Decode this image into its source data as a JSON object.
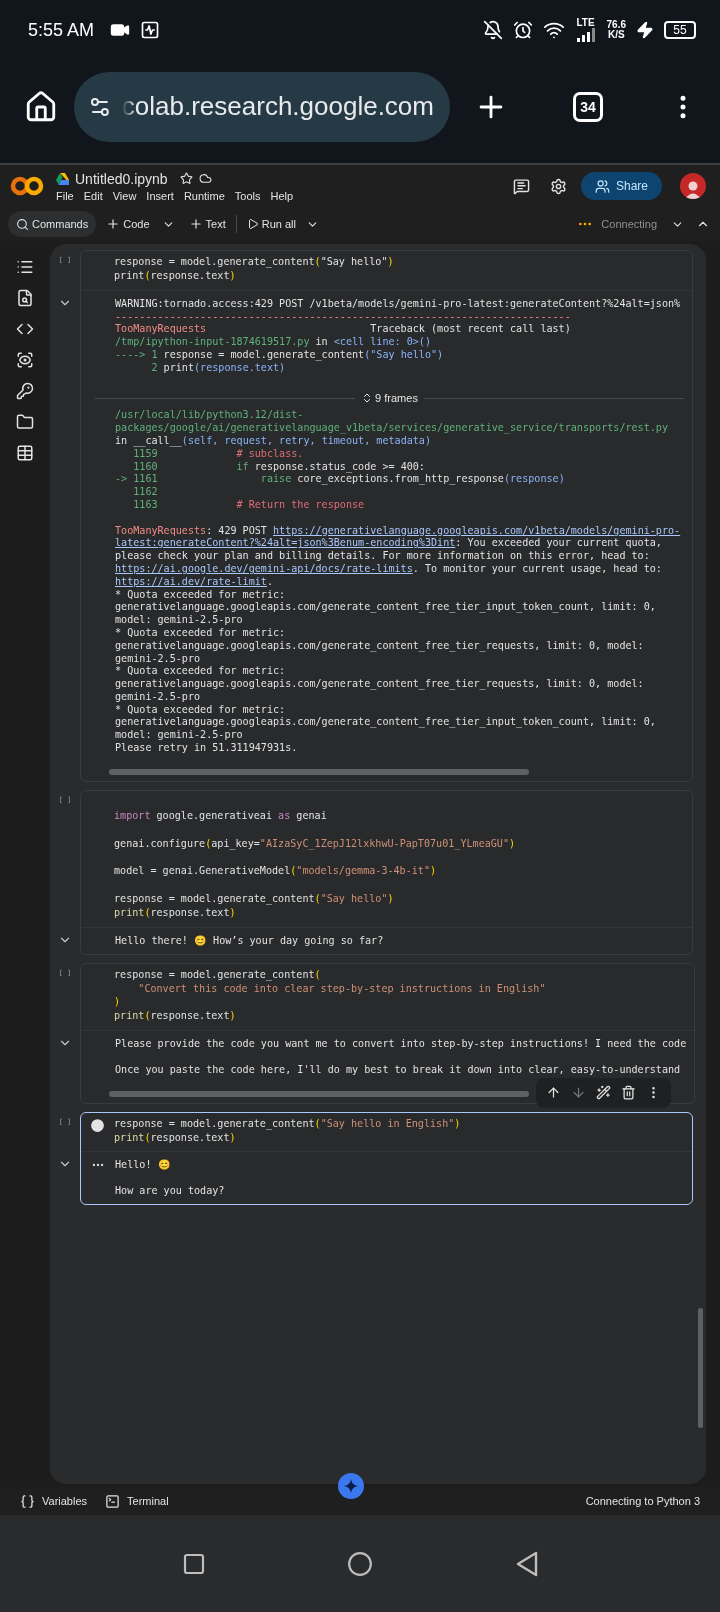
{
  "status_bar": {
    "time": "5:55 AM",
    "network": "LTE",
    "speed_value": "76.6",
    "speed_unit": "K/S",
    "battery": "55"
  },
  "browser": {
    "url": "colab.research.google.com",
    "tab_count": "34"
  },
  "notebook": {
    "title": "Untitled0.ipynb",
    "menu": [
      "File",
      "Edit",
      "View",
      "Insert",
      "Runtime",
      "Tools",
      "Help"
    ],
    "share_label": "Share"
  },
  "toolbar": {
    "commands": "Commands",
    "code": "Code",
    "text": "Text",
    "run_all": "Run all",
    "status": "Connecting"
  },
  "cells": [
    {
      "execution_count": "[ ]",
      "selected": false,
      "h_scrollbar": true,
      "code": [
        {
          "tokens": [
            {
              "kind": "plain",
              "text": "response = model.generate_content"
            },
            {
              "kind": "paren",
              "text": "("
            },
            {
              "kind": "plain",
              "text": "\"Say hello\""
            },
            {
              "kind": "paren",
              "text": ")"
            }
          ]
        },
        {
          "tokens": [
            {
              "kind": "plain",
              "text": "print"
            },
            {
              "kind": "paren",
              "text": "("
            },
            {
              "kind": "plain",
              "text": "response.text"
            },
            {
              "kind": "paren",
              "text": ")"
            }
          ]
        }
      ],
      "output": [
        {
          "tokens": [
            {
              "kind": "plain",
              "text": "WARNING:tornado.access:429 POST /v1beta/models/gemini-pro-latest:generateContent?%24alt=json%"
            }
          ]
        },
        {
          "tokens": [
            {
              "kind": "err",
              "text": "---------------------------------------------------------------------------"
            }
          ]
        },
        {
          "tokens": [
            {
              "kind": "err",
              "text": "TooManyRequests"
            },
            {
              "kind": "plain",
              "text": "                           Traceback (most recent call last)"
            }
          ]
        },
        {
          "tokens": [
            {
              "kind": "green",
              "text": "/tmp/ipython-input-1874619517.py"
            },
            {
              "kind": "plain",
              "text": " in "
            },
            {
              "kind": "blue",
              "text": "<cell line: 0>()"
            }
          ]
        },
        {
          "tokens": [
            {
              "kind": "green",
              "text": "----> 1"
            },
            {
              "kind": "plain",
              "text": " response = model.generate_content"
            },
            {
              "kind": "blue",
              "text": "(\"Say hello\")"
            }
          ]
        },
        {
          "tokens": [
            {
              "kind": "green",
              "text": "      2"
            },
            {
              "kind": "plain",
              "text": " print"
            },
            {
              "kind": "blue",
              "text": "(response.text)"
            }
          ]
        },
        {
          "kind": "blank"
        },
        {
          "kind": "frames",
          "label": "9 frames"
        },
        {
          "tokens": [
            {
              "kind": "green",
              "text": "/usr/local/lib/python3.12/dist-"
            }
          ]
        },
        {
          "tokens": [
            {
              "kind": "green",
              "text": "packages/google/ai/generativelanguage_v1beta/services/generative_service/transports/rest.py"
            }
          ]
        },
        {
          "tokens": [
            {
              "kind": "plain",
              "text": "in __call__"
            },
            {
              "kind": "blue",
              "text": "(self, request, retry, timeout, metadata)"
            }
          ]
        },
        {
          "tokens": [
            {
              "kind": "green",
              "text": "   1159"
            },
            {
              "kind": "comment",
              "text": "             # subclass."
            }
          ]
        },
        {
          "tokens": [
            {
              "kind": "green",
              "text": "   1160             if"
            },
            {
              "kind": "plain",
              "text": " response.status_code >= 400:"
            }
          ]
        },
        {
          "tokens": [
            {
              "kind": "green",
              "text": "-> 1161                 raise"
            },
            {
              "kind": "plain",
              "text": " core_exceptions.from_http_response"
            },
            {
              "kind": "blue",
              "text": "(response)"
            }
          ]
        },
        {
          "tokens": [
            {
              "kind": "green",
              "text": "   1162"
            }
          ]
        },
        {
          "tokens": [
            {
              "kind": "green",
              "text": "   1163"
            },
            {
              "kind": "comment",
              "text": "             # Return the response"
            }
          ]
        },
        {
          "kind": "blank"
        },
        {
          "tokens": [
            {
              "kind": "err",
              "text": "TooManyRequests"
            },
            {
              "kind": "plain",
              "text": ": 429 POST "
            },
            {
              "kind": "link",
              "text": "https://generativelanguage.googleapis.com/v1beta/models/gemini-pro-"
            }
          ]
        },
        {
          "tokens": [
            {
              "kind": "link",
              "text": "latest:generateContent?%24alt=json%3Benum-encoding%3Dint"
            },
            {
              "kind": "plain",
              "text": ": You exceeded your current quota,"
            }
          ]
        },
        {
          "tokens": [
            {
              "kind": "plain",
              "text": "please check your plan and billing details. For more information on this error, head to:"
            }
          ]
        },
        {
          "tokens": [
            {
              "kind": "link",
              "text": "https://ai.google.dev/gemini-api/docs/rate-limits"
            },
            {
              "kind": "plain",
              "text": ". To monitor your current usage, head to:"
            }
          ]
        },
        {
          "tokens": [
            {
              "kind": "link",
              "text": "https://ai.dev/rate-limit"
            },
            {
              "kind": "plain",
              "text": "."
            }
          ]
        },
        {
          "tokens": [
            {
              "kind": "plain",
              "text": "* Quota exceeded for metric:"
            }
          ]
        },
        {
          "tokens": [
            {
              "kind": "plain",
              "text": "generativelanguage.googleapis.com/generate_content_free_tier_input_token_count, limit: 0,"
            }
          ]
        },
        {
          "tokens": [
            {
              "kind": "plain",
              "text": "model: gemini-2.5-pro"
            }
          ]
        },
        {
          "tokens": [
            {
              "kind": "plain",
              "text": "* Quota exceeded for metric:"
            }
          ]
        },
        {
          "tokens": [
            {
              "kind": "plain",
              "text": "generativelanguage.googleapis.com/generate_content_free_tier_requests, limit: 0, model:"
            }
          ]
        },
        {
          "tokens": [
            {
              "kind": "plain",
              "text": "gemini-2.5-pro"
            }
          ]
        },
        {
          "tokens": [
            {
              "kind": "plain",
              "text": "* Quota exceeded for metric:"
            }
          ]
        },
        {
          "tokens": [
            {
              "kind": "plain",
              "text": "generativelanguage.googleapis.com/generate_content_free_tier_requests, limit: 0, model:"
            }
          ]
        },
        {
          "tokens": [
            {
              "kind": "plain",
              "text": "gemini-2.5-pro"
            }
          ]
        },
        {
          "tokens": [
            {
              "kind": "plain",
              "text": "* Quota exceeded for metric:"
            }
          ]
        },
        {
          "tokens": [
            {
              "kind": "plain",
              "text": "generativelanguage.googleapis.com/generate_content_free_tier_input_token_count, limit: 0,"
            }
          ]
        },
        {
          "tokens": [
            {
              "kind": "plain",
              "text": "model: gemini-2.5-pro"
            }
          ]
        },
        {
          "tokens": [
            {
              "kind": "plain",
              "text": "Please retry in 51.311947931s."
            }
          ]
        }
      ]
    },
    {
      "execution_count": "[ ]",
      "selected": false,
      "h_scrollbar": false,
      "code": [
        {
          "kind": "blank"
        },
        {
          "tokens": [
            {
              "kind": "kw",
              "text": "import"
            },
            {
              "kind": "plain",
              "text": " google.generativeai "
            },
            {
              "kind": "kw",
              "text": "as"
            },
            {
              "kind": "plain",
              "text": " genai"
            }
          ]
        },
        {
          "kind": "blank"
        },
        {
          "tokens": [
            {
              "kind": "plain",
              "text": "genai.configure"
            },
            {
              "kind": "paren",
              "text": "("
            },
            {
              "kind": "plain",
              "text": "api_key="
            },
            {
              "kind": "str",
              "text": "\"AIzaSyC_1ZepJ12lxkhwU-PapT07u01_YLmeaGU\""
            },
            {
              "kind": "paren",
              "text": ")"
            }
          ]
        },
        {
          "kind": "blank"
        },
        {
          "tokens": [
            {
              "kind": "plain",
              "text": "model = genai.GenerativeModel"
            },
            {
              "kind": "paren",
              "text": "("
            },
            {
              "kind": "str",
              "text": "\"models/gemma-3-4b-it\""
            },
            {
              "kind": "paren",
              "text": ")"
            }
          ]
        },
        {
          "kind": "blank"
        },
        {
          "tokens": [
            {
              "kind": "plain",
              "text": "response = model.generate_content"
            },
            {
              "kind": "paren",
              "text": "("
            },
            {
              "kind": "str",
              "text": "\"Say hello\""
            },
            {
              "kind": "paren",
              "text": ")"
            }
          ]
        },
        {
          "tokens": [
            {
              "kind": "fn",
              "text": "print"
            },
            {
              "kind": "paren",
              "text": "("
            },
            {
              "kind": "plain",
              "text": "response.text"
            },
            {
              "kind": "paren",
              "text": ")"
            }
          ]
        }
      ],
      "output": [
        {
          "tokens": [
            {
              "kind": "plain",
              "text": "Hello there! 😊 How’s your day going so far?"
            }
          ]
        }
      ]
    },
    {
      "execution_count": "[ ]",
      "selected": false,
      "h_scrollbar": true,
      "code": [
        {
          "tokens": [
            {
              "kind": "plain",
              "text": "response = model.generate_content"
            },
            {
              "kind": "paren",
              "text": "("
            }
          ]
        },
        {
          "tokens": [
            {
              "kind": "str",
              "text": "    \"Convert this code into clear step-by-step instructions in English\""
            }
          ]
        },
        {
          "tokens": [
            {
              "kind": "paren",
              "text": ")"
            }
          ]
        },
        {
          "tokens": [
            {
              "kind": "fn",
              "text": "print"
            },
            {
              "kind": "paren",
              "text": "("
            },
            {
              "kind": "plain",
              "text": "response.text"
            },
            {
              "kind": "paren",
              "text": ")"
            }
          ]
        }
      ],
      "output": [
        {
          "tokens": [
            {
              "kind": "plain",
              "text": "Please provide the code you want me to convert into step-by-step instructions! I need the code"
            }
          ]
        },
        {
          "kind": "blank"
        },
        {
          "tokens": [
            {
              "kind": "plain",
              "text": "Once you paste the code here, I'll do my best to break it down into clear, easy-to-understand"
            }
          ]
        }
      ]
    },
    {
      "execution_count": "[ ]",
      "selected": true,
      "toolbar_move_down_disabled": true,
      "h_scrollbar": false,
      "code": [
        {
          "tokens": [
            {
              "kind": "plain",
              "text": "response = model.generate_content"
            },
            {
              "kind": "paren",
              "text": "("
            },
            {
              "kind": "str",
              "text": "\"Say hello in English\""
            },
            {
              "kind": "paren",
              "text": ")"
            }
          ]
        },
        {
          "tokens": [
            {
              "kind": "fn",
              "text": "print"
            },
            {
              "kind": "paren",
              "text": "("
            },
            {
              "kind": "plain",
              "text": "response.text"
            },
            {
              "kind": "paren",
              "text": ")"
            }
          ]
        }
      ],
      "output": [
        {
          "tokens": [
            {
              "kind": "plain",
              "text": "Hello! 😊"
            }
          ]
        },
        {
          "kind": "blank"
        },
        {
          "tokens": [
            {
              "kind": "plain",
              "text": "How are you today?"
            }
          ]
        }
      ]
    }
  ],
  "footer": {
    "variables": "Variables",
    "terminal": "Terminal",
    "runtime_status": "Connecting to Python 3"
  }
}
